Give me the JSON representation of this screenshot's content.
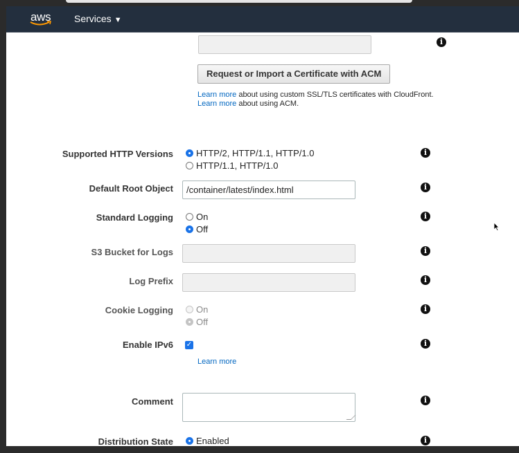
{
  "nav": {
    "logo_text": "aws",
    "services_label": "Services",
    "services_caret": "▼"
  },
  "ssl": {
    "request_button": "Request or Import a Certificate with ACM",
    "help": [
      {
        "link": "Learn more",
        "text": " about using custom SSL/TLS certificates with CloudFront."
      },
      {
        "link": "Learn more",
        "text": " about using ACM."
      }
    ]
  },
  "http_versions": {
    "label": "Supported HTTP Versions",
    "options": [
      "HTTP/2, HTTP/1.1, HTTP/1.0",
      "HTTP/1.1, HTTP/1.0"
    ],
    "selected": "HTTP/2, HTTP/1.1, HTTP/1.0"
  },
  "default_root_object": {
    "label": "Default Root Object",
    "value": "/container/latest/index.html"
  },
  "standard_logging": {
    "label": "Standard Logging",
    "options": [
      "On",
      "Off"
    ],
    "selected": "Off"
  },
  "s3_bucket": {
    "label": "S3 Bucket for Logs",
    "value": ""
  },
  "log_prefix": {
    "label": "Log Prefix",
    "value": ""
  },
  "cookie_logging": {
    "label": "Cookie Logging",
    "options": [
      "On",
      "Off"
    ],
    "selected": "Off"
  },
  "ipv6": {
    "label": "Enable IPv6",
    "checked": true,
    "learn_more": "Learn more"
  },
  "comment": {
    "label": "Comment",
    "value": ""
  },
  "distribution_state": {
    "label": "Distribution State",
    "selected": "Enabled"
  },
  "icons": {
    "info": "info-icon",
    "info_glyph": "i",
    "checkmark": "✓"
  },
  "colors": {
    "navbar": "#232f3e",
    "link": "#0066c0",
    "radio_selected": "#1a73e8"
  }
}
